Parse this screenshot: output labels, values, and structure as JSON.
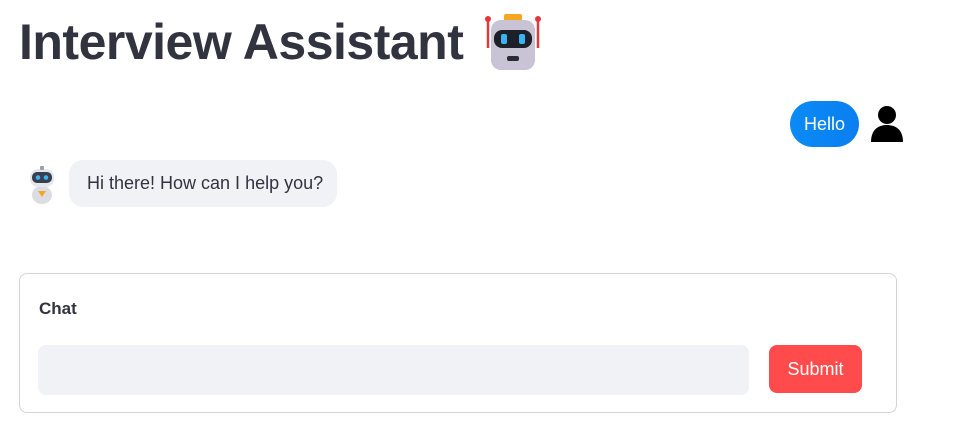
{
  "header": {
    "title": "Interview Assistant",
    "title_icon": "robot-face-icon"
  },
  "messages": [
    {
      "role": "user",
      "text": "Hello",
      "avatar_icon": "person-icon",
      "bubble_color": "#0a8bf5"
    },
    {
      "role": "assistant",
      "text": "Hi there! How can I help you?",
      "avatar_icon": "robot-icon",
      "bubble_color": "#f0f2f6"
    }
  ],
  "form": {
    "label": "Chat",
    "input_value": "",
    "input_placeholder": "",
    "submit_label": "Submit",
    "submit_color": "#ff4b4b"
  }
}
